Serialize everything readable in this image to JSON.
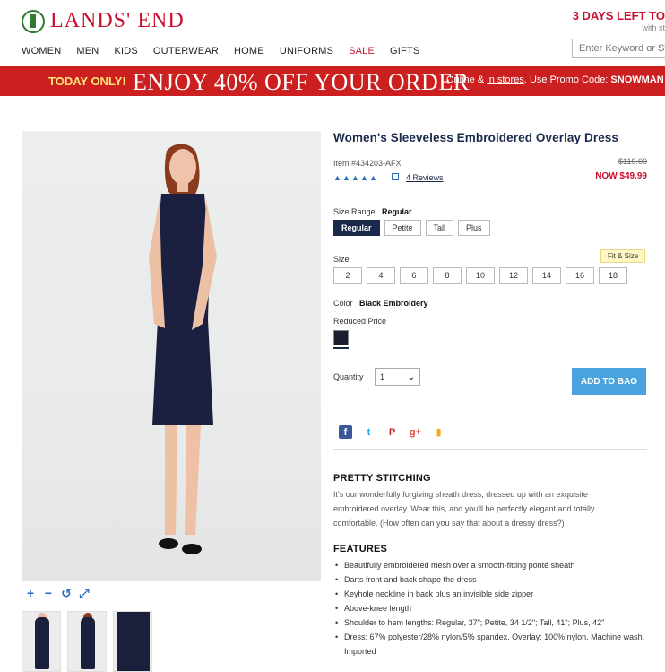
{
  "brand": {
    "name": "LANDS' END"
  },
  "promo_top": {
    "headline": "3 DAYS LEFT TO",
    "sub": "with st"
  },
  "nav": {
    "items": [
      {
        "label": "WOMEN"
      },
      {
        "label": "MEN"
      },
      {
        "label": "KIDS"
      },
      {
        "label": "OUTERWEAR"
      },
      {
        "label": "HOME"
      },
      {
        "label": "UNIFORMS"
      },
      {
        "label": "SALE"
      },
      {
        "label": "GIFTS"
      }
    ]
  },
  "search": {
    "placeholder": "Enter Keyword or Sty"
  },
  "banner": {
    "today": "TODAY ONLY!",
    "headline": "ENJOY 40% OFF YOUR ORDER",
    "sub_prefix": "Online & ",
    "sub_link": "in stores",
    "sub_suffix": ". Use Promo Code: ",
    "code": "SNOWMAN &",
    "bg_color": "#cc1f1f"
  },
  "zoom": {
    "icons": [
      "zoom-in-icon",
      "zoom-out-icon",
      "reset-icon",
      "fullscreen-icon"
    ],
    "labels": [
      "+",
      "−",
      "↺",
      "⤢"
    ]
  },
  "product": {
    "title": "Women's Sleeveless Embroidered Overlay Dress",
    "item": "Item #434203-AFX",
    "price_old": "$119.00",
    "price_now": "NOW $49.99",
    "rating": 5,
    "reviews": "4 Reviews",
    "size_range_label": "Size Range",
    "size_range_value": "Regular",
    "size_ranges": [
      "Regular",
      "Petite",
      "Tall",
      "Plus"
    ],
    "size_label": "Size",
    "fit_label": "Fit & Size",
    "sizes": [
      "2",
      "4",
      "6",
      "8",
      "10",
      "12",
      "14",
      "16",
      "18"
    ],
    "color_label": "Color",
    "color_value": "Black Embroidery",
    "reduced_label": "Reduced Price",
    "quantity_label": "Quantity",
    "quantity_value": "1",
    "add_to_bag": "ADD TO BAG"
  },
  "social": [
    {
      "name": "facebook-icon",
      "glyph": "f",
      "color": "#3b5998"
    },
    {
      "name": "twitter-icon",
      "glyph": "t",
      "color": "#1da1f2"
    },
    {
      "name": "pinterest-icon",
      "glyph": "P",
      "color": "#cb2027"
    },
    {
      "name": "google-plus-icon",
      "glyph": "g+",
      "color": "#dd4b39"
    },
    {
      "name": "shopping-bag-icon",
      "glyph": "▮",
      "color": "#f5a623"
    }
  ],
  "description": {
    "heading": "PRETTY STITCHING",
    "body": "It's our wonderfully forgiving sheath dress, dressed up with an exquisite embroidered overlay. Wear this, and you'll be perfectly elegant and totally comfortable. (How often can you say that about a dressy dress?)"
  },
  "features": {
    "heading": "FEATURES",
    "items": [
      "Beautifully embroidered mesh over a smooth-fitting ponté sheath",
      "Darts front and back shape the dress",
      "Keyhole neckline in back plus an invisible side zipper",
      "Above-knee length",
      "Shoulder to hem lengths: Regular, 37\"; Petite, 34 1/2\"; Tall, 41\"; Plus, 42\"",
      "Dress: 67% polyester/28% nylon/5% spandex. Overlay: 100% nylon. Machine wash. Imported"
    ]
  }
}
